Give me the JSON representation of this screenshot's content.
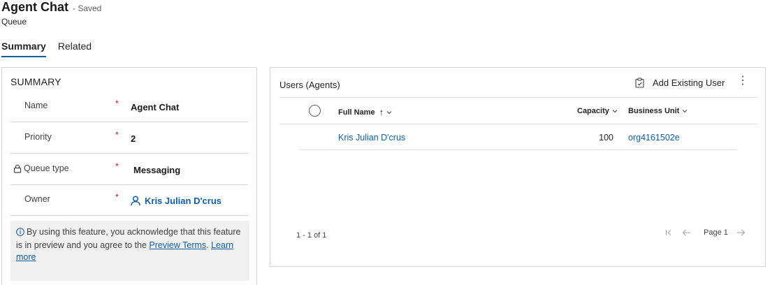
{
  "header": {
    "title": "Agent Chat",
    "saved": "- Saved",
    "entity": "Queue"
  },
  "tabs": [
    {
      "label": "Summary",
      "active": true
    },
    {
      "label": "Related",
      "active": false
    }
  ],
  "summary": {
    "section_title": "SUMMARY",
    "fields": [
      {
        "label": "Name",
        "required": "*",
        "value": "Agent Chat"
      },
      {
        "label": "Priority",
        "required": "*",
        "value": "2"
      },
      {
        "label": "Queue type",
        "required": "*",
        "value": "Messaging",
        "locked": true
      },
      {
        "label": "Owner",
        "required": "*",
        "value": "Kris Julian D'crus",
        "link": true
      }
    ],
    "notice": {
      "text": "By using this feature, you acknowledge that this feature is in preview and you agree to the",
      "terms_link": "Preview Terms",
      "period": ".",
      "learn_link": "Learn more"
    }
  },
  "users_grid": {
    "title": "Users (Agents)",
    "add_button": "Add Existing User",
    "more": "⋮",
    "columns": [
      {
        "label": "Full Name",
        "sort": "↑"
      },
      {
        "label": "Capacity"
      },
      {
        "label": "Business Unit"
      }
    ],
    "rows": [
      {
        "full_name": "Kris Julian D'crus",
        "capacity": "100",
        "business_unit": "org4161502e"
      }
    ],
    "count": "1 - 1 of 1",
    "page": "Page 1"
  },
  "colors": {
    "accent": "#115ea3",
    "required": "#c50f1f",
    "border": "#d6d6d6",
    "notice_bg": "#f0f0f0"
  }
}
